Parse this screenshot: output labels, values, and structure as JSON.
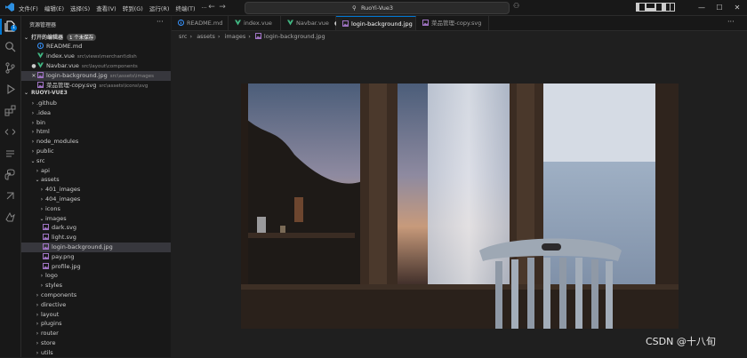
{
  "menu": [
    "文件(F)",
    "编辑(E)",
    "选择(S)",
    "查看(V)",
    "转到(G)",
    "运行(R)",
    "终端(T)"
  ],
  "search": {
    "label": "RuoYi-Vue3"
  },
  "sidebar": {
    "title": "资源管理器",
    "open_editors": {
      "label": "打开的编辑器",
      "badge": "1 个未保存"
    },
    "open_files": [
      {
        "name": "README.md",
        "path": "",
        "icon": "info-icon",
        "color": "#3794ff",
        "marker": ""
      },
      {
        "name": "index.vue",
        "path": "src\\views\\merchant\\dish",
        "icon": "vue-icon",
        "color": "#41b883",
        "marker": ""
      },
      {
        "name": "Navbar.vue",
        "path": "src\\layout\\components",
        "icon": "vue-icon",
        "color": "#41b883",
        "marker": "●"
      },
      {
        "name": "login-background.jpg",
        "path": "src\\assets\\images",
        "icon": "image-icon",
        "color": "#a074c4",
        "marker": "✕"
      },
      {
        "name": "菜品管理-copy.svg",
        "path": "src\\assets\\icons\\svg",
        "icon": "svg-icon",
        "color": "#a074c4",
        "marker": ""
      }
    ],
    "project": "RUOYI-VUE3",
    "tree": [
      {
        "name": ".github",
        "caret": "›"
      },
      {
        "name": ".idea",
        "caret": "›"
      },
      {
        "name": "bin",
        "caret": "›"
      },
      {
        "name": "html",
        "caret": "›"
      },
      {
        "name": "node_modules",
        "caret": "›"
      },
      {
        "name": "public",
        "caret": "›"
      },
      {
        "name": "src",
        "caret": "⌄"
      },
      {
        "name": "api",
        "caret": "›"
      },
      {
        "name": "assets",
        "caret": "⌄"
      },
      {
        "name": "401_images",
        "caret": "›"
      },
      {
        "name": "404_images",
        "caret": "›"
      },
      {
        "name": "icons",
        "caret": "›"
      },
      {
        "name": "images",
        "caret": "⌄"
      },
      {
        "name": "dark.svg",
        "caret": ""
      },
      {
        "name": "light.svg",
        "caret": ""
      },
      {
        "name": "login-background.jpg",
        "caret": ""
      },
      {
        "name": "pay.png",
        "caret": ""
      },
      {
        "name": "profile.jpg",
        "caret": ""
      },
      {
        "name": "logo",
        "caret": "›"
      },
      {
        "name": "styles",
        "caret": "›"
      },
      {
        "name": "components",
        "caret": "›"
      },
      {
        "name": "directive",
        "caret": "›"
      },
      {
        "name": "layout",
        "caret": "›"
      },
      {
        "name": "plugins",
        "caret": "›"
      },
      {
        "name": "router",
        "caret": "›"
      },
      {
        "name": "store",
        "caret": "›"
      },
      {
        "name": "utils",
        "caret": "›"
      }
    ]
  },
  "tabs": [
    {
      "label": "README.md",
      "icon": "info-icon",
      "color": "#3794ff",
      "dirty": false,
      "active": false
    },
    {
      "label": "index.vue",
      "icon": "vue-icon",
      "color": "#41b883",
      "dirty": false,
      "active": false
    },
    {
      "label": "Navbar.vue",
      "icon": "vue-icon",
      "color": "#41b883",
      "dirty": true,
      "active": false
    },
    {
      "label": "login-background.jpg",
      "icon": "image-icon",
      "color": "#a074c4",
      "dirty": false,
      "active": true
    },
    {
      "label": "菜品管理-copy.svg",
      "icon": "svg-icon",
      "color": "#a074c4",
      "dirty": false,
      "active": false
    }
  ],
  "breadcrumb": [
    "src",
    "assets",
    "images",
    "login-background.jpg"
  ],
  "watermark": "CSDN @十八旬",
  "colors": {
    "accent": "#0078d4",
    "vue": "#41b883",
    "media": "#a074c4",
    "info": "#3794ff"
  }
}
